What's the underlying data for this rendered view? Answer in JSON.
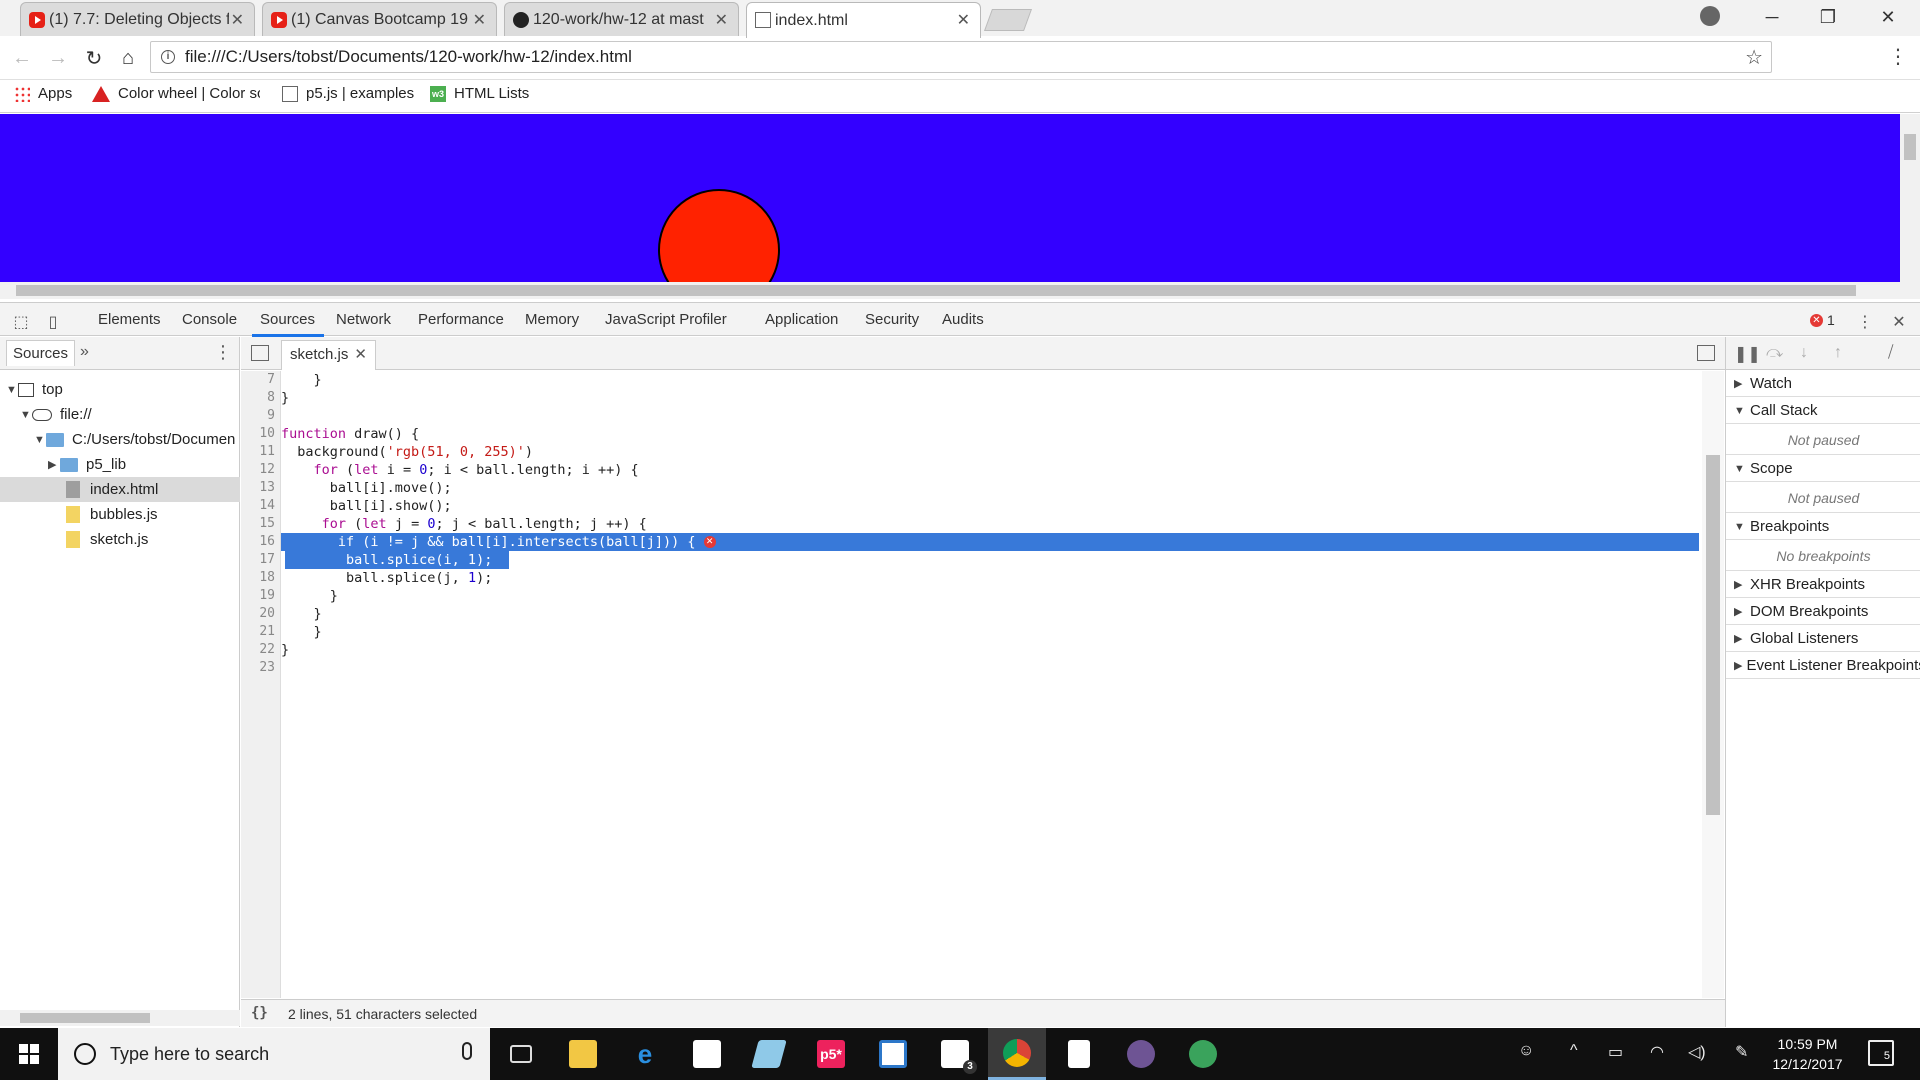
{
  "browser": {
    "tabs": [
      {
        "title": "(1) 7.7: Deleting Objects f",
        "icon": "youtube-icon"
      },
      {
        "title": "(1) Canvas Bootcamp 19",
        "icon": "youtube-icon"
      },
      {
        "title": "120-work/hw-12 at mast",
        "icon": "github-icon"
      },
      {
        "title": "index.html",
        "icon": "document-icon"
      }
    ],
    "url": "file:///C:/Users/tobst/Documents/120-work/hw-12/index.html",
    "bookmarks": [
      "Apps",
      "Color wheel | Color sc",
      "p5.js | examples",
      "HTML Lists"
    ],
    "bookmark_w3_label": "w3"
  },
  "page": {
    "background": "#3300ff",
    "ball_color": "#ff2200"
  },
  "devtools": {
    "tabs": [
      "Elements",
      "Console",
      "Sources",
      "Network",
      "Performance",
      "Memory",
      "JavaScript Profiler",
      "Application",
      "Security",
      "Audits"
    ],
    "active_tab": "Sources",
    "error_count": "1",
    "navigator": {
      "tab": "Sources",
      "tree": [
        "top",
        "file://",
        "C:/Users/tobst/Documen",
        "p5_lib",
        "index.html",
        "bubbles.js",
        "sketch.js"
      ]
    },
    "editor": {
      "file_tab": "sketch.js",
      "line_numbers": [
        "7",
        "8",
        "9",
        "10",
        "11",
        "12",
        "13",
        "14",
        "15",
        "16",
        "17",
        "18",
        "19",
        "20",
        "21",
        "22",
        "23"
      ],
      "status": "2 lines, 51 characters selected",
      "braces": "{}"
    },
    "debugger": {
      "watch": "Watch",
      "call_stack": "Call Stack",
      "call_stack_body": "Not paused",
      "scope": "Scope",
      "scope_body": "Not paused",
      "breakpoints": "Breakpoints",
      "breakpoints_body": "No breakpoints",
      "xhr": "XHR Breakpoints",
      "dom": "DOM Breakpoints",
      "global": "Global Listeners",
      "event": "Event Listener Breakpoints"
    }
  },
  "taskbar": {
    "search_placeholder": "Type here to search",
    "time": "10:59 PM",
    "date": "12/12/2017",
    "notifications": "5",
    "mail_badge": "3",
    "p5_label": "p5*"
  }
}
